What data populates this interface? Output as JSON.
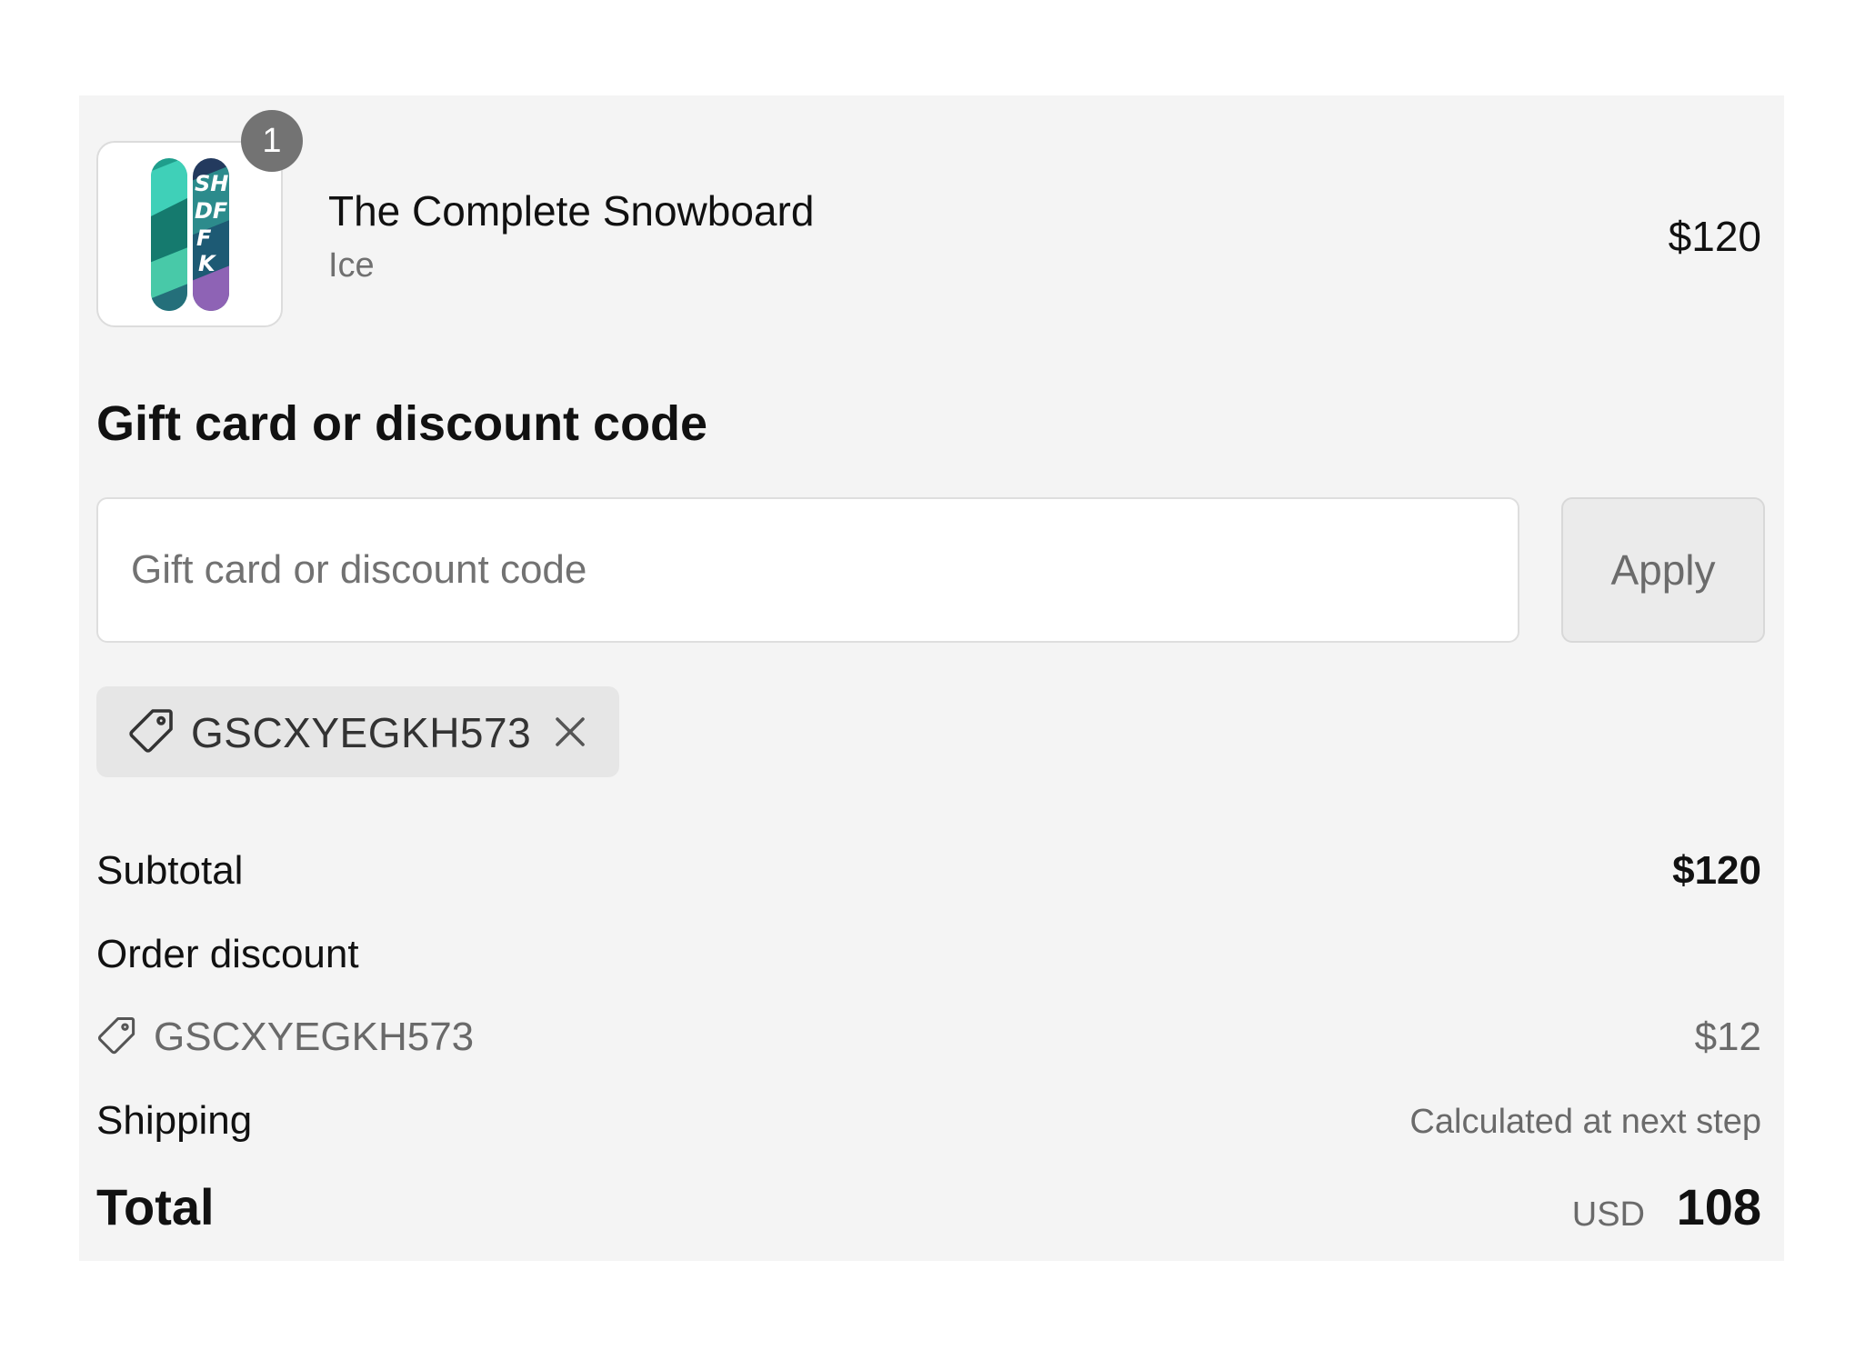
{
  "product": {
    "quantity": "1",
    "title": "The Complete Snowboard",
    "variant": "Ice",
    "price": "$120",
    "image_icon": "snowboard-image"
  },
  "discount": {
    "heading": "Gift card or discount code",
    "input_placeholder": "Gift card or discount code",
    "input_value": "",
    "apply_label": "Apply",
    "applied_code": "GSCXYEGKH573",
    "tag_icon": "tag-icon",
    "remove_icon": "close-icon"
  },
  "summary": {
    "subtotal_label": "Subtotal",
    "subtotal_value": "$120",
    "order_discount_label": "Order discount",
    "discount_code": "GSCXYEGKH573",
    "discount_amount": "$12",
    "shipping_label": "Shipping",
    "shipping_value": "Calculated at next step",
    "total_label": "Total",
    "total_currency": "USD",
    "total_amount": "108"
  },
  "colors": {
    "panel_background": "#f4f4f4",
    "badge": "#737373",
    "chip_background": "#e6e6e6",
    "muted_text": "#6a6a6a"
  }
}
